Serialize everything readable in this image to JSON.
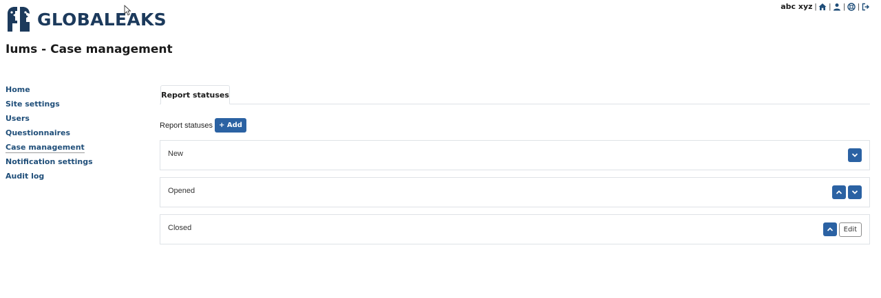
{
  "brand": {
    "name": "GLOBALEAKS",
    "color": "#1c3a5c"
  },
  "page": {
    "title": "Iums - Case management"
  },
  "topbar": {
    "username": "abc xyz",
    "separator": "|",
    "icons": [
      "home-icon",
      "user-icon",
      "support-icon",
      "logout-icon"
    ]
  },
  "sidebar": {
    "items": [
      {
        "label": "Home"
      },
      {
        "label": "Site settings"
      },
      {
        "label": "Users"
      },
      {
        "label": "Questionnaires"
      },
      {
        "label": "Case management",
        "active": true
      },
      {
        "label": "Notification settings"
      },
      {
        "label": "Audit log"
      }
    ]
  },
  "tabs": [
    {
      "label": "Report statuses",
      "active": true
    }
  ],
  "section": {
    "label": "Report statuses",
    "add_label": "+ Add"
  },
  "statuses": [
    {
      "name": "New",
      "controls": [
        "chevron-down"
      ]
    },
    {
      "name": "Opened",
      "controls": [
        "chevron-up",
        "chevron-down"
      ]
    },
    {
      "name": "Closed",
      "controls": [
        "chevron-up",
        "edit"
      ]
    }
  ],
  "edit_label": "Edit",
  "colors": {
    "accent": "#2b62a3",
    "link": "#1f4e79",
    "border": "#dee2e6"
  }
}
